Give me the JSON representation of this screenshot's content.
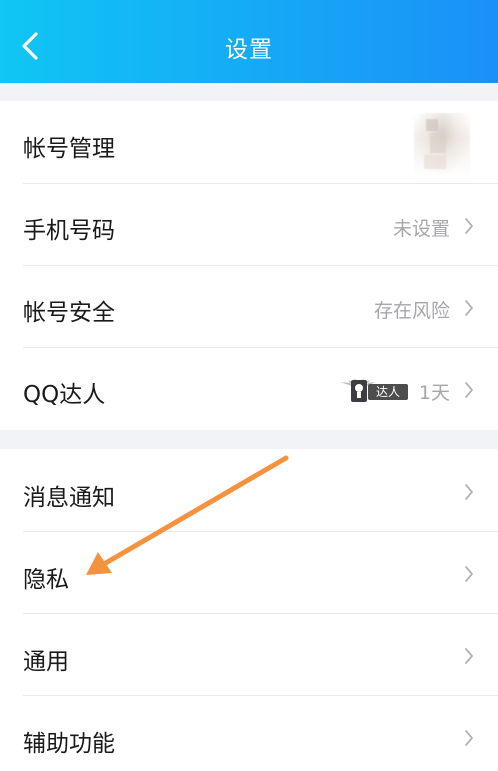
{
  "header": {
    "title": "设置"
  },
  "groups": [
    {
      "rows": [
        {
          "label": "帐号管理",
          "value": ""
        },
        {
          "label": "手机号码",
          "value": "未设置"
        },
        {
          "label": "帐号安全",
          "value": "存在风险"
        },
        {
          "label": "QQ达人",
          "value": "1天",
          "badge": "达人"
        }
      ]
    },
    {
      "rows": [
        {
          "label": "消息通知"
        },
        {
          "label": "隐私"
        },
        {
          "label": "通用"
        },
        {
          "label": "辅助功能"
        }
      ]
    }
  ],
  "icons": {
    "back": "chevron-left-icon",
    "row_arrow": "chevron-right-icon",
    "badge_icon": "winged-badge-icon"
  },
  "colors": {
    "header_start": "#10c6f4",
    "header_end": "#1a90f8",
    "annotation_arrow": "#f5923e"
  }
}
